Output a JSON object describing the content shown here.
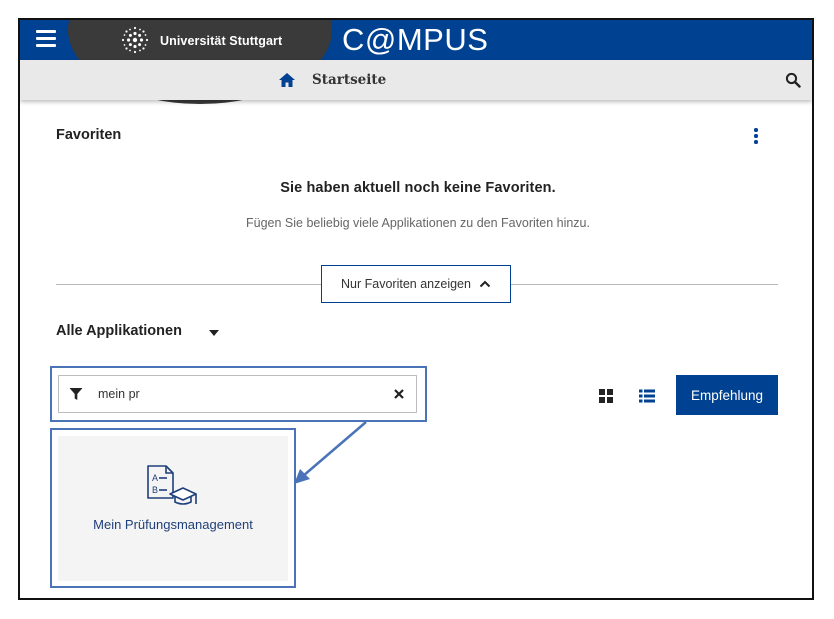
{
  "header": {
    "university_name": "Universität Stuttgart",
    "app_name": "C@MPUS",
    "brand_color": "#004191"
  },
  "breadcrumb": {
    "home_label": "Startseite"
  },
  "favorites": {
    "title": "Favoriten",
    "empty_heading": "Sie haben aktuell noch keine Favoriten.",
    "empty_hint": "Fügen Sie beliebig viele Applikationen zu den Favoriten hinzu.",
    "toggle_label": "Nur Favoriten anzeigen"
  },
  "applications": {
    "section_title": "Alle Applikationen",
    "filter_value": "mein pr",
    "recommend_label": "Empfehlung",
    "tiles": [
      {
        "label": "Mein Prüfungsmanagement",
        "icon": "exam-management-icon"
      }
    ]
  },
  "icons": {
    "menu": "hamburger-menu-icon",
    "home": "home-icon",
    "search": "search-icon",
    "more": "kebab-menu-icon",
    "filter": "filter-funnel-icon",
    "clear": "close-icon",
    "grid": "grid-view-icon",
    "list": "list-view-icon"
  },
  "annotation_color": "#4a74b7"
}
